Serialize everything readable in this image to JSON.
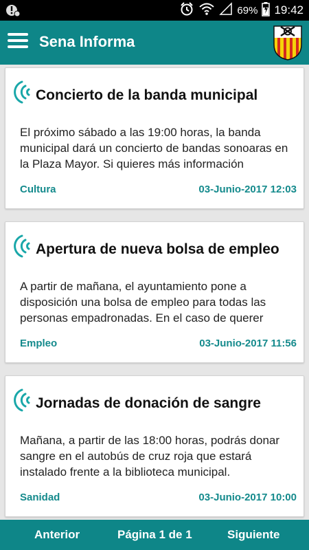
{
  "status_bar": {
    "battery": "69%",
    "time": "19:42",
    "icons": [
      "notification-icon",
      "alarm-icon",
      "wifi-icon",
      "signal-icon",
      "battery-icon"
    ]
  },
  "app_bar": {
    "title": "Sena Informa",
    "icons": [
      "menu-icon",
      "coat-of-arms-icon"
    ]
  },
  "news": [
    {
      "title": "Concierto de la banda municipal",
      "body": "El próximo sábado a las 19:00 horas, la banda municipal dará un concierto de bandas sonoaras en la Plaza Mayor. Si quieres más información",
      "category": "Cultura",
      "date": "03-Junio-2017 12:03"
    },
    {
      "title": "Apertura de nueva bolsa de empleo",
      "body": "A partir de mañana, el ayuntamiento pone a disposición una bolsa de empleo para todas las personas empadronadas. En el caso de querer",
      "category": "Empleo",
      "date": "03-Junio-2017 11:56"
    },
    {
      "title": "Jornadas de donación de sangre",
      "body": "Mañana, a partir de las 18:00 horas, podrás donar sangre en el autobús de cruz roja que estará instalado frente a la biblioteca municipal.",
      "category": "Sanidad",
      "date": "03-Junio-2017 10:00"
    }
  ],
  "pagination": {
    "prev": "Anterior",
    "page": "Página 1 de 1",
    "next": "Siguiente"
  },
  "colors": {
    "primary": "#0e8688",
    "accent_text": "#148a8c",
    "background": "#e6e6e6"
  }
}
